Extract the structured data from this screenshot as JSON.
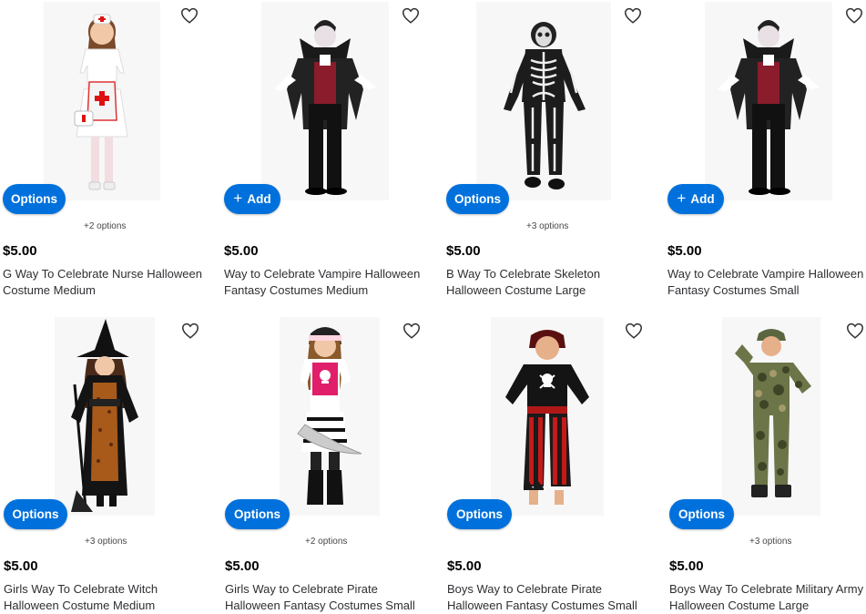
{
  "accent_color": "#0071dc",
  "products": [
    {
      "title": "G Way To Celebrate Nurse Halloween Costume Medium",
      "price": "$5.00",
      "button": "Options",
      "options_count": "+2 options",
      "image": "nurse-costume-child"
    },
    {
      "title": "Way to Celebrate Vampire Halloween Fantasy Costumes Medium",
      "price": "$5.00",
      "button": "Add",
      "options_count": "",
      "image": "vampire-costume-child"
    },
    {
      "title": "B Way To Celebrate Skeleton Halloween Costume Large",
      "price": "$5.00",
      "button": "Options",
      "options_count": "+3 options",
      "image": "skeleton-costume-child"
    },
    {
      "title": "Way to Celebrate Vampire Halloween Fantasy Costumes Small",
      "price": "$5.00",
      "button": "Add",
      "options_count": "",
      "image": "vampire-costume-child"
    },
    {
      "title": "Girls Way To Celebrate Witch Halloween Costume Medium",
      "price": "$5.00",
      "button": "Options",
      "options_count": "+3 options",
      "image": "witch-costume-child"
    },
    {
      "title": "Girls Way to Celebrate Pirate Halloween Fantasy Costumes Small",
      "price": "$5.00",
      "button": "Options",
      "options_count": "+2 options",
      "image": "pirate-girl-costume-child"
    },
    {
      "title": "Boys Way to Celebrate Pirate Halloween Fantasy Costumes Small",
      "price": "$5.00",
      "button": "Options",
      "options_count": "",
      "image": "pirate-boy-costume-child"
    },
    {
      "title": "Boys Way To Celebrate Military Army Halloween Costume Large",
      "price": "$5.00",
      "button": "Options",
      "options_count": "+3 options",
      "image": "army-costume-child"
    }
  ]
}
